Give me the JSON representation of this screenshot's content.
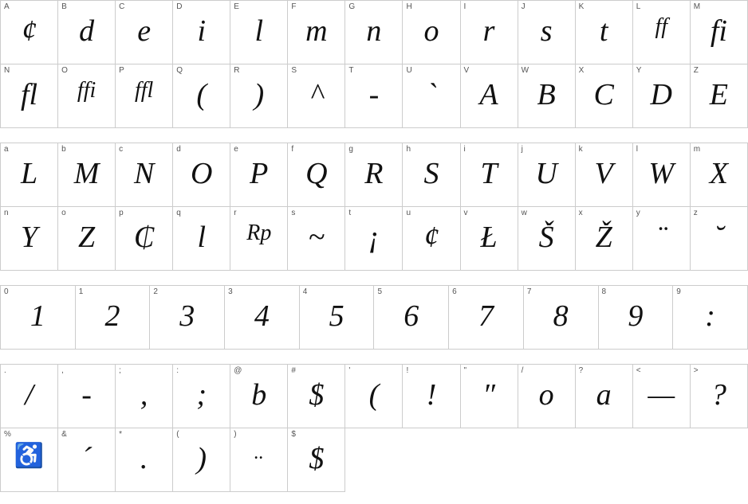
{
  "sections": [
    {
      "rows": [
        {
          "cells": [
            {
              "key": "A",
              "glyph": "¢"
            },
            {
              "key": "B",
              "glyph": "d"
            },
            {
              "key": "C",
              "glyph": "e"
            },
            {
              "key": "D",
              "glyph": "i"
            },
            {
              "key": "E",
              "glyph": "l"
            },
            {
              "key": "F",
              "glyph": "m"
            },
            {
              "key": "G",
              "glyph": "n"
            },
            {
              "key": "H",
              "glyph": "o"
            },
            {
              "key": "I",
              "glyph": "r"
            },
            {
              "key": "J",
              "glyph": "s"
            },
            {
              "key": "K",
              "glyph": "t"
            },
            {
              "key": "L",
              "glyph": "ff"
            },
            {
              "key": "M",
              "glyph": "fi"
            }
          ]
        },
        {
          "cells": [
            {
              "key": "N",
              "glyph": "fl"
            },
            {
              "key": "O",
              "glyph": "ffi"
            },
            {
              "key": "P",
              "glyph": "ffl"
            },
            {
              "key": "Q",
              "glyph": "("
            },
            {
              "key": "R",
              "glyph": ")"
            },
            {
              "key": "S",
              "glyph": "^"
            },
            {
              "key": "T",
              "glyph": "-"
            },
            {
              "key": "U",
              "glyph": "`"
            },
            {
              "key": "V",
              "glyph": "A"
            },
            {
              "key": "W",
              "glyph": "B"
            },
            {
              "key": "X",
              "glyph": "C"
            },
            {
              "key": "Y",
              "glyph": "D"
            },
            {
              "key": "Z",
              "glyph": "E"
            }
          ]
        }
      ]
    },
    {
      "rows": [
        {
          "cells": [
            {
              "key": "a",
              "glyph": "L"
            },
            {
              "key": "b",
              "glyph": "M"
            },
            {
              "key": "c",
              "glyph": "N"
            },
            {
              "key": "d",
              "glyph": "O"
            },
            {
              "key": "e",
              "glyph": "P"
            },
            {
              "key": "f",
              "glyph": "Q"
            },
            {
              "key": "g",
              "glyph": "R"
            },
            {
              "key": "h",
              "glyph": "S"
            },
            {
              "key": "i",
              "glyph": "T"
            },
            {
              "key": "j",
              "glyph": "U"
            },
            {
              "key": "k",
              "glyph": "V"
            },
            {
              "key": "l",
              "glyph": "W"
            },
            {
              "key": "m",
              "glyph": "X"
            }
          ]
        },
        {
          "cells": [
            {
              "key": "n",
              "glyph": "Y"
            },
            {
              "key": "o",
              "glyph": "Z"
            },
            {
              "key": "p",
              "glyph": "₵"
            },
            {
              "key": "q",
              "glyph": "l"
            },
            {
              "key": "r",
              "glyph": "Rp"
            },
            {
              "key": "s",
              "glyph": "~"
            },
            {
              "key": "t",
              "glyph": "¡"
            },
            {
              "key": "u",
              "glyph": "¢"
            },
            {
              "key": "v",
              "glyph": "Ł"
            },
            {
              "key": "w",
              "glyph": "Š"
            },
            {
              "key": "x",
              "glyph": "Ž"
            },
            {
              "key": "y",
              "glyph": "¨"
            },
            {
              "key": "z",
              "glyph": "˘"
            }
          ]
        }
      ]
    },
    {
      "rows": [
        {
          "cells": [
            {
              "key": "0",
              "glyph": "1"
            },
            {
              "key": "1",
              "glyph": "2"
            },
            {
              "key": "2",
              "glyph": "3"
            },
            {
              "key": "3",
              "glyph": "4"
            },
            {
              "key": "4",
              "glyph": "5"
            },
            {
              "key": "5",
              "glyph": "6"
            },
            {
              "key": "6",
              "glyph": "7"
            },
            {
              "key": "7",
              "glyph": "8"
            },
            {
              "key": "8",
              "glyph": "9"
            },
            {
              "key": "9",
              "glyph": ":"
            }
          ]
        }
      ]
    },
    {
      "rows": [
        {
          "cells": [
            {
              "key": ".",
              "glyph": "/"
            },
            {
              "key": ",",
              "glyph": "-"
            },
            {
              "key": ";",
              "glyph": ","
            },
            {
              "key": ":",
              "glyph": ";"
            },
            {
              "key": "@",
              "glyph": "b"
            },
            {
              "key": "#",
              "glyph": "$"
            },
            {
              "key": "'",
              "glyph": "("
            },
            {
              "key": "!",
              "glyph": "!"
            },
            {
              "key": "\"",
              "glyph": "″"
            },
            {
              "key": "/",
              "glyph": "o"
            },
            {
              "key": "?",
              "glyph": "a"
            },
            {
              "key": "<",
              "glyph": "—"
            },
            {
              "key": ">",
              "glyph": "?"
            }
          ]
        },
        {
          "cells": [
            {
              "key": "%",
              "glyph": "♿"
            },
            {
              "key": "&",
              "glyph": "´"
            },
            {
              "key": "*",
              "glyph": "."
            },
            {
              "key": "(",
              "glyph": ")"
            },
            {
              "key": ")",
              "glyph": ".."
            },
            {
              "key": "$",
              "glyph": "$"
            }
          ]
        }
      ]
    }
  ]
}
